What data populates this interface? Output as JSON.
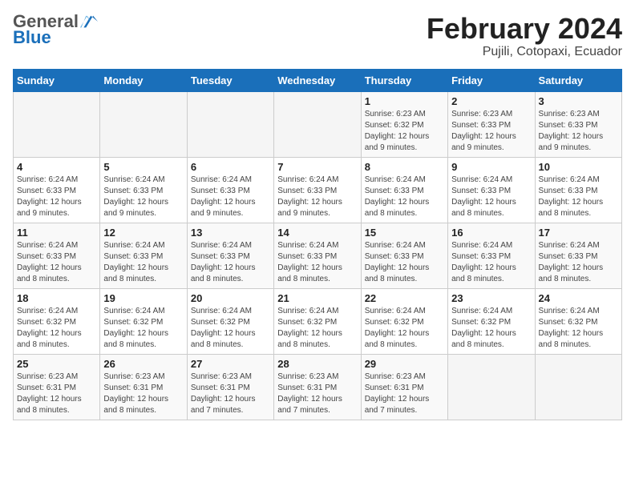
{
  "logo": {
    "general": "General",
    "blue": "Blue"
  },
  "title": "February 2024",
  "subtitle": "Pujili, Cotopaxi, Ecuador",
  "days_header": [
    "Sunday",
    "Monday",
    "Tuesday",
    "Wednesday",
    "Thursday",
    "Friday",
    "Saturday"
  ],
  "weeks": [
    [
      {
        "day": "",
        "info": ""
      },
      {
        "day": "",
        "info": ""
      },
      {
        "day": "",
        "info": ""
      },
      {
        "day": "",
        "info": ""
      },
      {
        "day": "1",
        "info": "Sunrise: 6:23 AM\nSunset: 6:32 PM\nDaylight: 12 hours\nand 9 minutes."
      },
      {
        "day": "2",
        "info": "Sunrise: 6:23 AM\nSunset: 6:33 PM\nDaylight: 12 hours\nand 9 minutes."
      },
      {
        "day": "3",
        "info": "Sunrise: 6:23 AM\nSunset: 6:33 PM\nDaylight: 12 hours\nand 9 minutes."
      }
    ],
    [
      {
        "day": "4",
        "info": "Sunrise: 6:24 AM\nSunset: 6:33 PM\nDaylight: 12 hours\nand 9 minutes."
      },
      {
        "day": "5",
        "info": "Sunrise: 6:24 AM\nSunset: 6:33 PM\nDaylight: 12 hours\nand 9 minutes."
      },
      {
        "day": "6",
        "info": "Sunrise: 6:24 AM\nSunset: 6:33 PM\nDaylight: 12 hours\nand 9 minutes."
      },
      {
        "day": "7",
        "info": "Sunrise: 6:24 AM\nSunset: 6:33 PM\nDaylight: 12 hours\nand 9 minutes."
      },
      {
        "day": "8",
        "info": "Sunrise: 6:24 AM\nSunset: 6:33 PM\nDaylight: 12 hours\nand 8 minutes."
      },
      {
        "day": "9",
        "info": "Sunrise: 6:24 AM\nSunset: 6:33 PM\nDaylight: 12 hours\nand 8 minutes."
      },
      {
        "day": "10",
        "info": "Sunrise: 6:24 AM\nSunset: 6:33 PM\nDaylight: 12 hours\nand 8 minutes."
      }
    ],
    [
      {
        "day": "11",
        "info": "Sunrise: 6:24 AM\nSunset: 6:33 PM\nDaylight: 12 hours\nand 8 minutes."
      },
      {
        "day": "12",
        "info": "Sunrise: 6:24 AM\nSunset: 6:33 PM\nDaylight: 12 hours\nand 8 minutes."
      },
      {
        "day": "13",
        "info": "Sunrise: 6:24 AM\nSunset: 6:33 PM\nDaylight: 12 hours\nand 8 minutes."
      },
      {
        "day": "14",
        "info": "Sunrise: 6:24 AM\nSunset: 6:33 PM\nDaylight: 12 hours\nand 8 minutes."
      },
      {
        "day": "15",
        "info": "Sunrise: 6:24 AM\nSunset: 6:33 PM\nDaylight: 12 hours\nand 8 minutes."
      },
      {
        "day": "16",
        "info": "Sunrise: 6:24 AM\nSunset: 6:33 PM\nDaylight: 12 hours\nand 8 minutes."
      },
      {
        "day": "17",
        "info": "Sunrise: 6:24 AM\nSunset: 6:33 PM\nDaylight: 12 hours\nand 8 minutes."
      }
    ],
    [
      {
        "day": "18",
        "info": "Sunrise: 6:24 AM\nSunset: 6:32 PM\nDaylight: 12 hours\nand 8 minutes."
      },
      {
        "day": "19",
        "info": "Sunrise: 6:24 AM\nSunset: 6:32 PM\nDaylight: 12 hours\nand 8 minutes."
      },
      {
        "day": "20",
        "info": "Sunrise: 6:24 AM\nSunset: 6:32 PM\nDaylight: 12 hours\nand 8 minutes."
      },
      {
        "day": "21",
        "info": "Sunrise: 6:24 AM\nSunset: 6:32 PM\nDaylight: 12 hours\nand 8 minutes."
      },
      {
        "day": "22",
        "info": "Sunrise: 6:24 AM\nSunset: 6:32 PM\nDaylight: 12 hours\nand 8 minutes."
      },
      {
        "day": "23",
        "info": "Sunrise: 6:24 AM\nSunset: 6:32 PM\nDaylight: 12 hours\nand 8 minutes."
      },
      {
        "day": "24",
        "info": "Sunrise: 6:24 AM\nSunset: 6:32 PM\nDaylight: 12 hours\nand 8 minutes."
      }
    ],
    [
      {
        "day": "25",
        "info": "Sunrise: 6:23 AM\nSunset: 6:31 PM\nDaylight: 12 hours\nand 8 minutes."
      },
      {
        "day": "26",
        "info": "Sunrise: 6:23 AM\nSunset: 6:31 PM\nDaylight: 12 hours\nand 8 minutes."
      },
      {
        "day": "27",
        "info": "Sunrise: 6:23 AM\nSunset: 6:31 PM\nDaylight: 12 hours\nand 7 minutes."
      },
      {
        "day": "28",
        "info": "Sunrise: 6:23 AM\nSunset: 6:31 PM\nDaylight: 12 hours\nand 7 minutes."
      },
      {
        "day": "29",
        "info": "Sunrise: 6:23 AM\nSunset: 6:31 PM\nDaylight: 12 hours\nand 7 minutes."
      },
      {
        "day": "",
        "info": ""
      },
      {
        "day": "",
        "info": ""
      }
    ]
  ]
}
